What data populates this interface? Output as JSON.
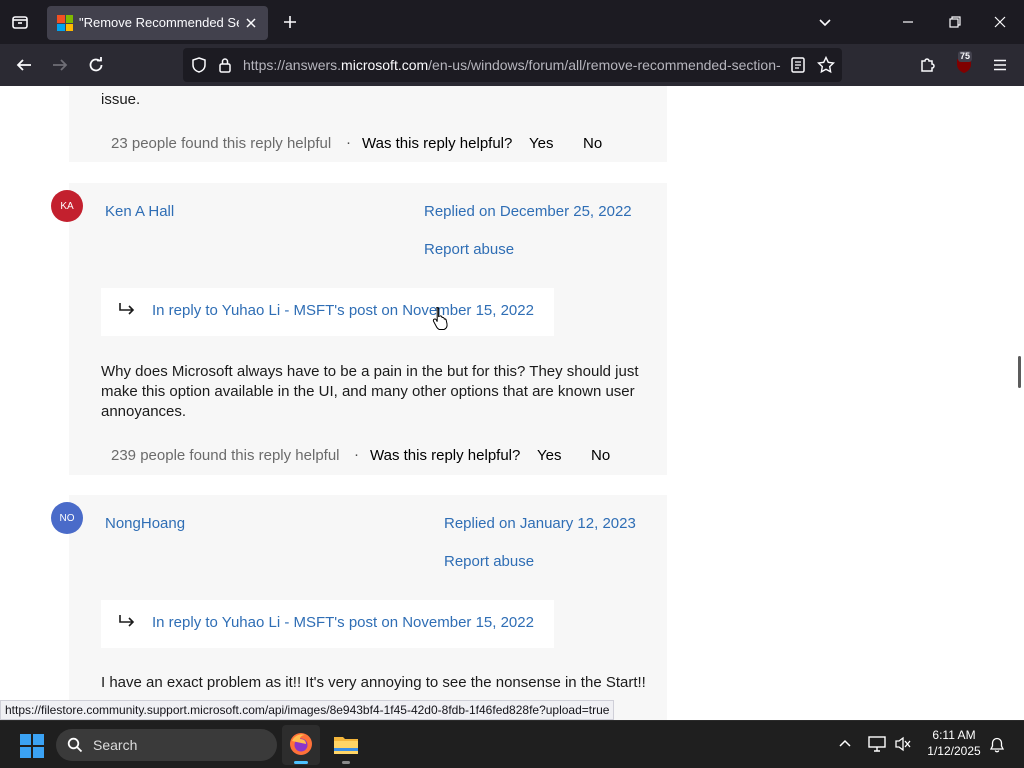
{
  "browser": {
    "tab_title": "\"Remove Recommended Section",
    "url_prefix": "https://answers.",
    "url_domain": "microsoft.com",
    "url_rest": "/en-us/windows/forum/all/remove-recommended-section-",
    "extensions_badge": "75"
  },
  "first_card": {
    "tail_text": "issue.",
    "helpful_count": "23 people found this reply helpful",
    "helpful_question": "Was this reply helpful?",
    "yes": "Yes",
    "no": "No"
  },
  "replies": [
    {
      "avatar_initials": "KA",
      "avatar_color": "#c3202e",
      "author": "Ken A Hall",
      "replied_on": "Replied on December 25, 2022",
      "report": "Report abuse",
      "in_reply_to": "In reply to Yuhao Li - MSFT's post on November 15, 2022",
      "body": "Why does Microsoft always have to be a pain in the but for this? They should just make this option available in the UI, and many other options that are known user annoyances.",
      "helpful_count": "239 people found this reply helpful",
      "helpful_question": "Was this reply helpful?",
      "yes": "Yes",
      "no": "No"
    },
    {
      "avatar_initials": "NO",
      "avatar_color": "#4a6bc9",
      "author": "NongHoang",
      "replied_on": "Replied on January 12, 2023",
      "report": "Report abuse",
      "in_reply_to": "In reply to Yuhao Li - MSFT's post on November 15, 2022",
      "body": "I have an exact problem as it!! It's very annoying to see the nonsense in the Start!!"
    }
  ],
  "status_url": "https://filestore.community.support.microsoft.com/api/images/8e943bf4-1f45-42d0-8fdb-1f46fed828fe?upload=true",
  "taskbar": {
    "search_label": "Search",
    "time": "6:11 AM",
    "date": "1/12/2025"
  }
}
